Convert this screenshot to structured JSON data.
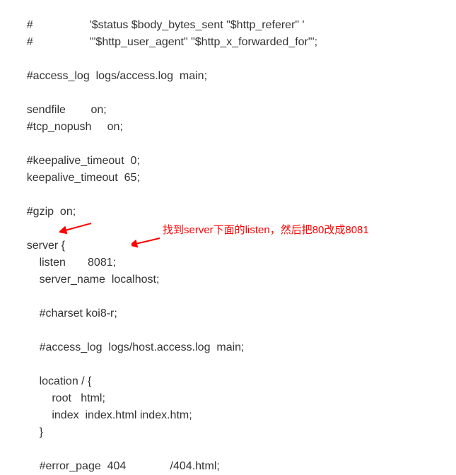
{
  "code": {
    "line1": "    #                  '$status $body_bytes_sent \"$http_referer\" '",
    "line2": "    #                  '\"$http_user_agent\" \"$http_x_forwarded_for\"';",
    "line3": "",
    "line4": "    #access_log  logs/access.log  main;",
    "line5": "",
    "line6": "    sendfile        on;",
    "line7": "    #tcp_nopush     on;",
    "line8": "",
    "line9": "    #keepalive_timeout  0;",
    "line10": "    keepalive_timeout  65;",
    "line11": "",
    "line12": "    #gzip  on;",
    "line13": "",
    "line14": "    server {",
    "line15": "        listen       8081;",
    "line16": "        server_name  localhost;",
    "line17": "",
    "line18": "        #charset koi8-r;",
    "line19": "",
    "line20": "        #access_log  logs/host.access.log  main;",
    "line21": "",
    "line22": "        location / {",
    "line23": "            root   html;",
    "line24": "            index  index.html index.htm;",
    "line25": "        }",
    "line26": "",
    "line27": "        #error_page  404              /404.html;"
  },
  "annotation": {
    "text": "找到server下面的listen，然后把80改成8081",
    "arrow_color": "#ff0000"
  }
}
